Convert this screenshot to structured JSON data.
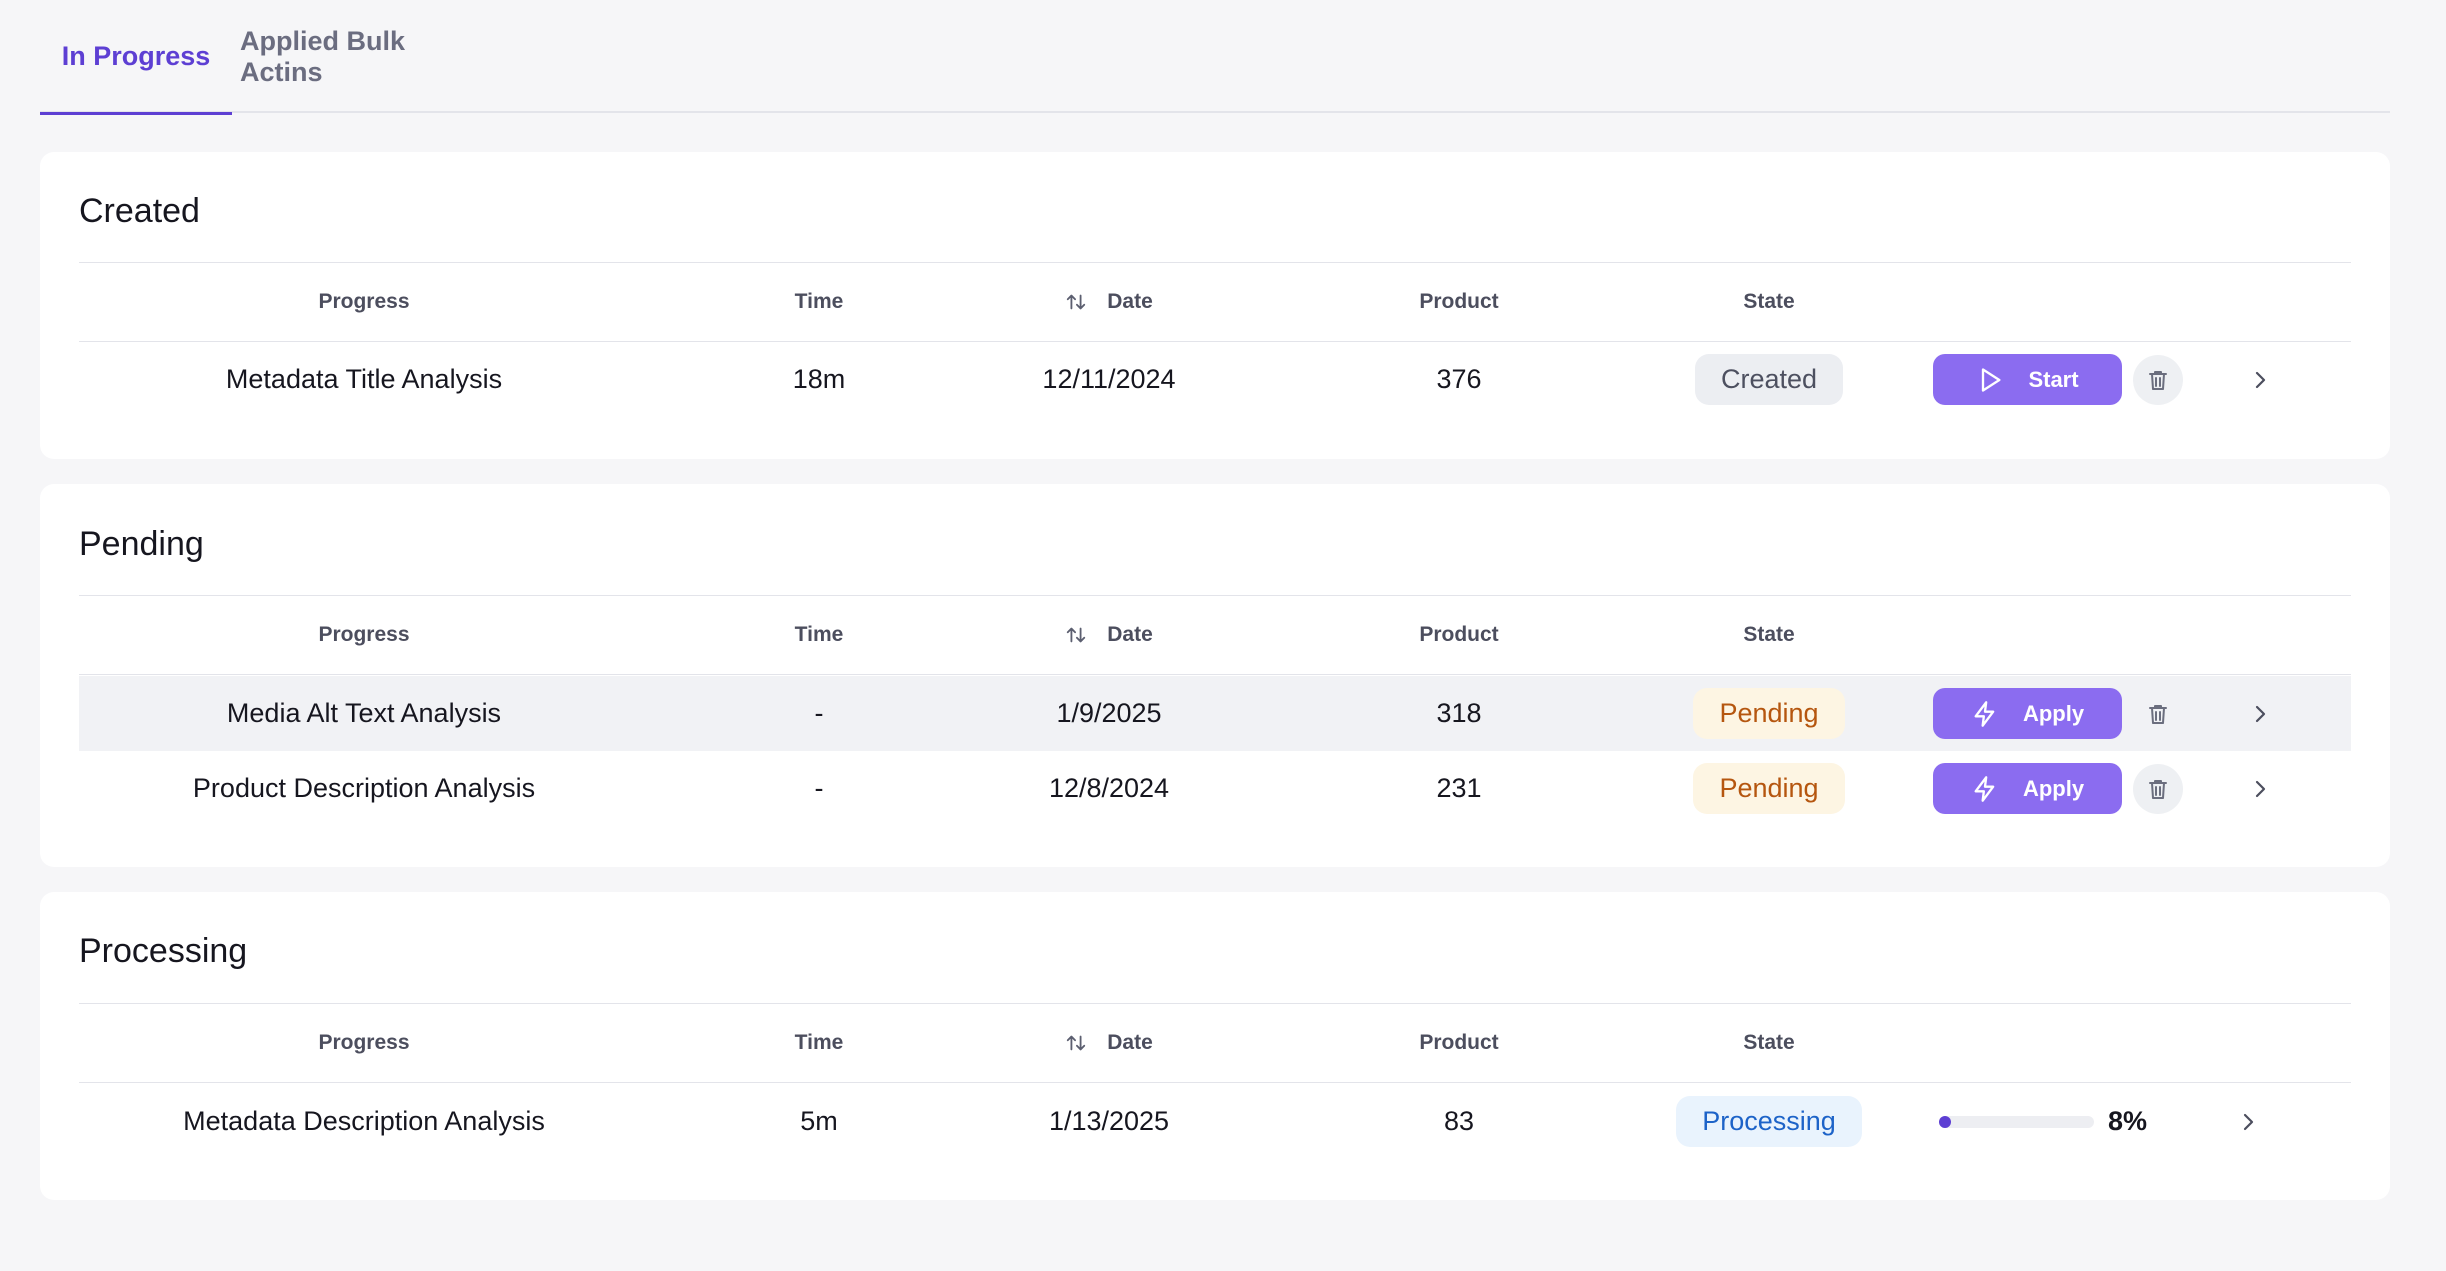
{
  "tabs": [
    {
      "label": "In Progress",
      "active": true
    },
    {
      "label": "Applied Bulk Actins",
      "active": false
    }
  ],
  "columns": {
    "progress": "Progress",
    "time": "Time",
    "date": "Date",
    "product": "Product",
    "state": "State"
  },
  "sections": {
    "created": {
      "title": "Created",
      "rows": [
        {
          "name": "Metadata Title Analysis",
          "time": "18m",
          "date": "12/11/2024",
          "product": "376",
          "state": "Created",
          "action": "Start"
        }
      ]
    },
    "pending": {
      "title": "Pending",
      "rows": [
        {
          "name": "Media Alt Text Analysis",
          "time": "-",
          "date": "1/9/2025",
          "product": "318",
          "state": "Pending",
          "action": "Apply"
        },
        {
          "name": "Product Description Analysis",
          "time": "-",
          "date": "12/8/2024",
          "product": "231",
          "state": "Pending",
          "action": "Apply"
        }
      ]
    },
    "processing": {
      "title": "Processing",
      "rows": [
        {
          "name": "Metadata Description Analysis",
          "time": "5m",
          "date": "1/13/2025",
          "product": "83",
          "state": "Processing",
          "progress_percent": 8,
          "progress_label": "8%"
        }
      ]
    }
  },
  "colors": {
    "accent": "#5d3fd3",
    "button": "#8b6cf0",
    "pending_text": "#b5560f",
    "processing_text": "#1d63c8"
  },
  "icons": {
    "start": "play-icon",
    "apply": "lightning-icon",
    "delete": "trash-icon",
    "open": "chevron-right-icon",
    "sort": "sort-icon"
  }
}
